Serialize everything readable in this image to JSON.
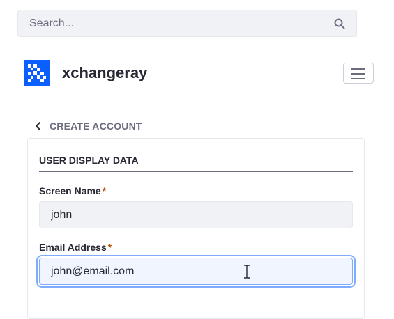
{
  "search": {
    "placeholder": "Search..."
  },
  "header": {
    "brand": "xchangeray"
  },
  "nav": {
    "back_label": "CREATE ACCOUNT"
  },
  "form": {
    "section_title": "USER DISPLAY DATA",
    "required_marker": "*",
    "fields": [
      {
        "label": "Screen Name",
        "value": "john"
      },
      {
        "label": "Email Address",
        "value": "john@email.com"
      }
    ]
  },
  "icons": {
    "search": "search-icon",
    "logo": "logo-icon",
    "menu": "hamburger-menu-icon",
    "back": "chevron-left-icon",
    "cursor": "text-cursor-icon"
  },
  "colors": {
    "brand": "#0b5fff",
    "required": "#b95000",
    "focus": "#80acff"
  }
}
